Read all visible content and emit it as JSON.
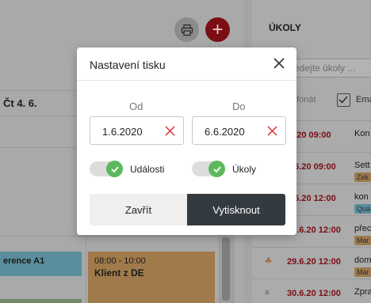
{
  "calendar": {
    "day_label": "Čt 4. 6.",
    "events": [
      {
        "title": "erence A1"
      },
      {
        "time": "08:00 - 10:00",
        "title": "Klient z DE"
      }
    ]
  },
  "tasks": {
    "title": "ÚKOLY",
    "search_placeholder": "edejte úkoly ...",
    "filter_phone": "efonát",
    "filter_email": "Ema",
    "items": [
      {
        "date": ".6.20 09:00",
        "title": "Kon",
        "tag": ""
      },
      {
        "date": "2.6.20 09:00",
        "title": "Sett",
        "tag": "Zek"
      },
      {
        "date": "9.6.20 12:00",
        "title": "kon",
        "tag": "Qua"
      },
      {
        "date": "28.6.20 12:00",
        "title": "přec",
        "tag": "Mar"
      },
      {
        "date": "29.6.20 12:00",
        "title": "dom",
        "tag": "Mar"
      },
      {
        "date": "30.6.20 12:00",
        "title": "Zpra",
        "tag": ""
      }
    ]
  },
  "modal": {
    "title": "Nastavení tisku",
    "from_label": "Od",
    "to_label": "Do",
    "from_value": "1.6.2020",
    "to_value": "6.6.2020",
    "toggle_events_label": "Události",
    "toggle_tasks_label": "Úkoly",
    "close_button": "Zavřít",
    "print_button": "Vytisknout"
  },
  "colors": {
    "accent_red": "#a3141c",
    "toggle_green": "#5cb85c",
    "primary_dark": "#333a40"
  }
}
